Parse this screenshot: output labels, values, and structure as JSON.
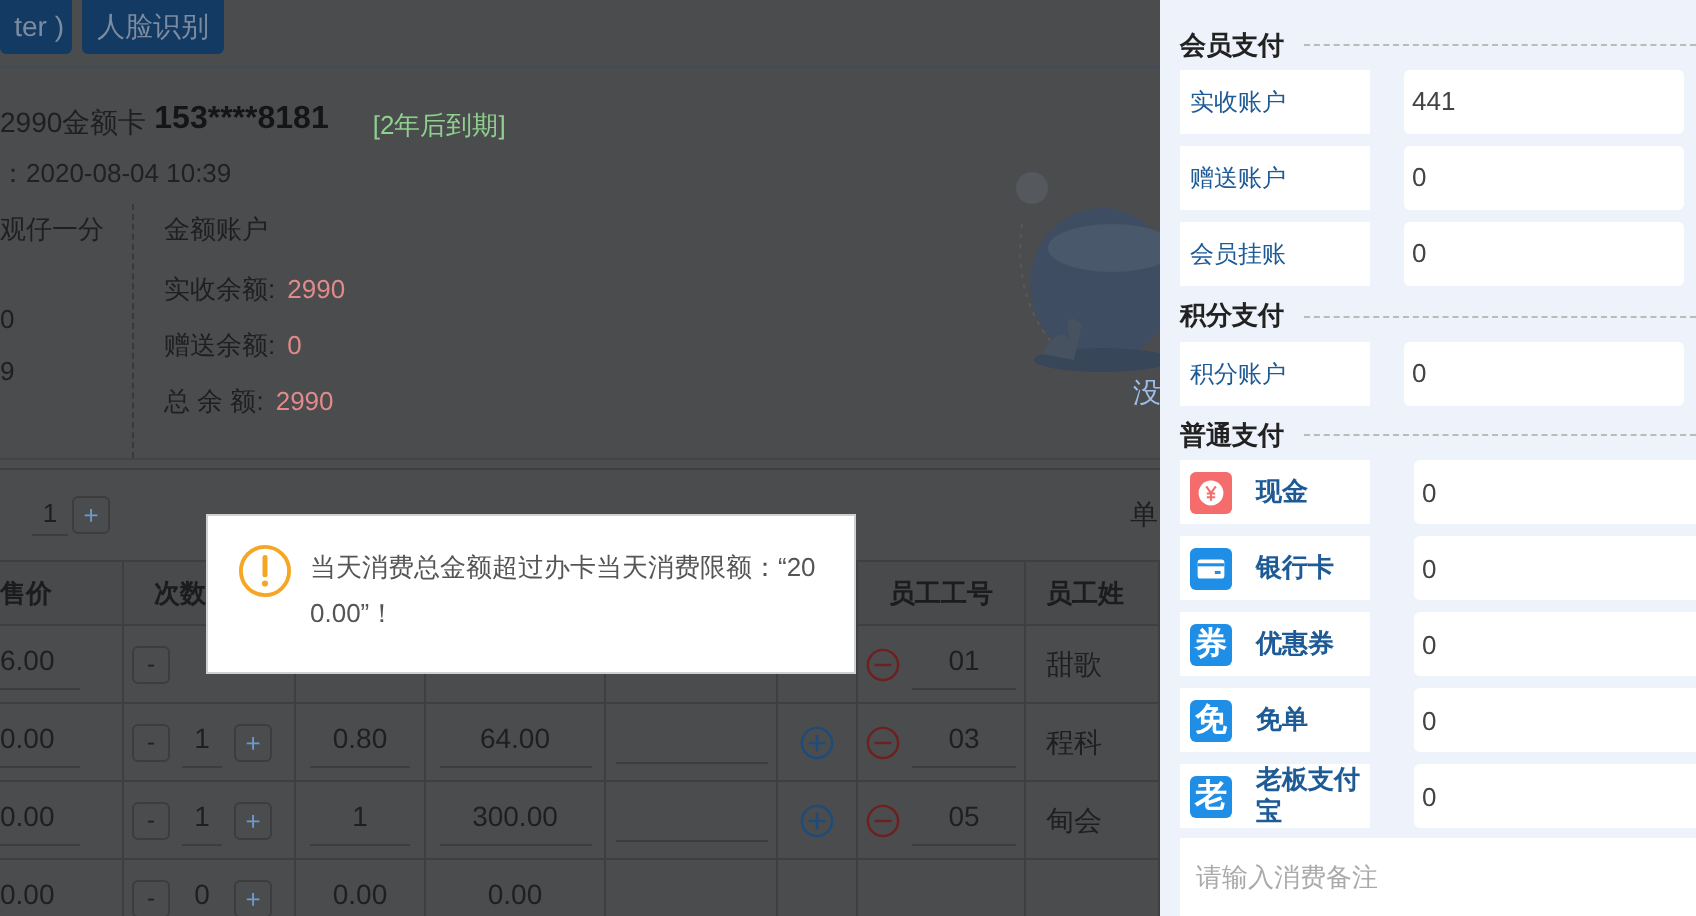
{
  "top_buttons": [
    {
      "label": "ter )"
    },
    {
      "label": "人脸识别"
    }
  ],
  "card": {
    "name": "2990金额卡",
    "number": "153****8181",
    "expiry": "[2年后到期]",
    "opened": "：2020-08-04 10:39"
  },
  "member": {
    "lines": [
      "观仔一分",
      "0",
      "9"
    ]
  },
  "account": {
    "title": "金额账户",
    "items": [
      {
        "label": "实收余额:",
        "value": "2990"
      },
      {
        "label": "赠送余额:",
        "value": "0"
      },
      {
        "label": "总 余 额:",
        "value": "2990"
      }
    ]
  },
  "empty_state": {
    "text": "没"
  },
  "quantity": {
    "value": "1",
    "plus": "+"
  },
  "unit_label": "单",
  "table": {
    "columns": [
      "售价",
      "次数",
      "员工工号",
      "员工姓"
    ],
    "rows": [
      {
        "price": "6.00",
        "minus": "-",
        "remove": true,
        "staff_no": "01",
        "staff_name": "甜歌"
      },
      {
        "price": "0.00",
        "minus": "-",
        "count": "1",
        "plus": "+",
        "discount": "0.80",
        "amount": "64.00",
        "add": true,
        "remove": true,
        "staff_no": "03",
        "staff_name": "程科"
      },
      {
        "price": "0.00",
        "minus": "-",
        "count": "1",
        "plus": "+",
        "discount": "1",
        "amount": "300.00",
        "add": true,
        "remove": true,
        "staff_no": "05",
        "staff_name": "甸会"
      },
      {
        "price": "0.00",
        "minus": "-",
        "count": "0",
        "plus": "+",
        "discount": "0.00",
        "amount": "0.00"
      }
    ]
  },
  "dialog": {
    "message": "当天消费总金额超过办卡当天消费限额：“200.00”！"
  },
  "payment": {
    "sections": [
      {
        "title": "会员支付",
        "rows": [
          {
            "label": "实收账户",
            "value": "441"
          },
          {
            "label": "赠送账户",
            "value": "0"
          },
          {
            "label": "会员挂账",
            "value": "0"
          }
        ]
      },
      {
        "title": "积分支付",
        "rows": [
          {
            "label": "积分账户",
            "value": "0"
          }
        ]
      },
      {
        "title": "普通支付",
        "rows": [
          {
            "label": "现金",
            "kind": "cash",
            "value": "0"
          },
          {
            "label": "银行卡",
            "kind": "card",
            "value": "0"
          },
          {
            "label": "优惠券",
            "kind": "glyph",
            "glyph": "券",
            "value": "0"
          },
          {
            "label": "免单",
            "kind": "glyph",
            "glyph": "免",
            "value": "0"
          },
          {
            "label": "老板支付宝",
            "kind": "glyph",
            "glyph": "老",
            "value": "0"
          }
        ]
      }
    ],
    "remark": {
      "placeholder": "请输入消费备注"
    }
  }
}
